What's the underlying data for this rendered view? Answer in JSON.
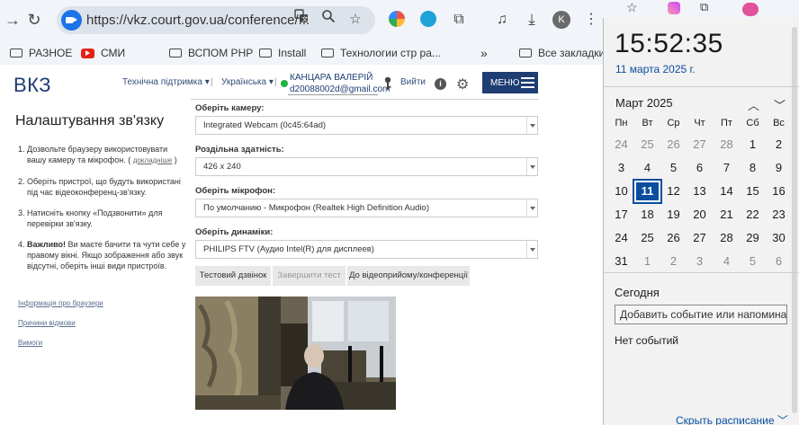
{
  "browser": {
    "url": "https://vkz.court.gov.ua/conference/...",
    "profile_initial": "K",
    "bookmarks": [
      "РАЗНОЕ",
      "СМИ",
      "ВСПОМ PHP",
      "Install",
      "Технологии стр ра...",
      "»",
      "Все закладки"
    ]
  },
  "header": {
    "logo": "ВКЗ",
    "support": "Технічна підтримка ▾",
    "sep1": "|",
    "language": "Українська ▾",
    "sep2": "|",
    "user_name": "КАНЦАРА ВАЛЕРІЙ",
    "user_email": "d20088002d@gmail.com",
    "logout": "Вийти",
    "info": "i",
    "menu": "МЕНЮ"
  },
  "sidebar": {
    "title": "Налаштування зв'язку",
    "steps": [
      {
        "num": "1.",
        "text": "Дозвольте браузеру використовувати вашу камеру та мікрофон. ( ",
        "link": "докладніше",
        "tail": " )"
      },
      {
        "num": "2.",
        "text": "Оберіть пристрої, що будуть використані під час відеоконференц-зв'язку."
      },
      {
        "num": "3.",
        "text": "Натисніть кнопку «Подзвонити» для перевірки зв'язку."
      },
      {
        "num": "4.",
        "bold": "Важливо!",
        "text": " Ви маєте бачити та чути себе у правому вікні. Якщо зображення або звук відсутні, оберіть інші види пристроїв."
      }
    ],
    "links": [
      "Інформація про браузери",
      "Причини відмови",
      "Вимоги"
    ]
  },
  "form": {
    "camera_label": "Оберіть камеру:",
    "camera_value": "Integrated Webcam (0c45:64ad)",
    "resolution_label": "Роздільна здатність:",
    "resolution_value": "426 x 240",
    "mic_label": "Оберіть мікрофон:",
    "mic_value": "По умолчанию - Микрофон (Realtek High Definition Audio)",
    "speakers_label": "Оберіть динаміки:",
    "speakers_value": "PHILIPS FTV (Аудио Intel(R) для дисплеев)",
    "btn_test": "Тестовий дзвінок",
    "btn_end": "Завершити тест",
    "btn_room": "До відеоприйому/конференції"
  },
  "calendar": {
    "time": "15:52:35",
    "date": "11 марта 2025 г.",
    "month": "Март 2025",
    "weekdays": [
      "Пн",
      "Вт",
      "Ср",
      "Чт",
      "Пт",
      "Сб",
      "Вс"
    ],
    "days": [
      [
        "24",
        "25",
        "26",
        "27",
        "28",
        "1",
        "2"
      ],
      [
        "3",
        "4",
        "5",
        "6",
        "7",
        "8",
        "9"
      ],
      [
        "10",
        "11",
        "12",
        "13",
        "14",
        "15",
        "16"
      ],
      [
        "17",
        "18",
        "19",
        "20",
        "21",
        "22",
        "23"
      ],
      [
        "24",
        "25",
        "26",
        "27",
        "28",
        "29",
        "30"
      ],
      [
        "31",
        "1",
        "2",
        "3",
        "4",
        "5",
        "6"
      ]
    ],
    "today_label": "Сегодня",
    "add_event_placeholder": "Добавить событие или напомина",
    "no_events": "Нет событий",
    "hide_schedule": "Скрыть расписание ﹀"
  }
}
